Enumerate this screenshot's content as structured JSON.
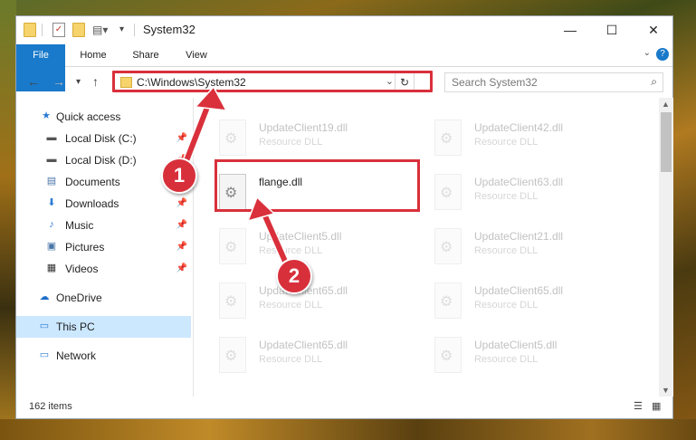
{
  "window": {
    "title": "System32",
    "controls": {
      "minimize": "—",
      "maximize": "☐",
      "close": "✕"
    }
  },
  "ribbon": {
    "tabs": [
      "File",
      "Home",
      "Share",
      "View"
    ],
    "help": "?"
  },
  "address_bar": {
    "path": "C:\\Windows\\System32"
  },
  "search": {
    "placeholder": "Search System32"
  },
  "sidebar": {
    "items": [
      {
        "label": "Quick access",
        "icon": "star-icon",
        "pinned": false
      },
      {
        "label": "Local Disk (C:)",
        "icon": "drive-icon",
        "pinned": true
      },
      {
        "label": "Local Disk (D:)",
        "icon": "drive-icon",
        "pinned": true
      },
      {
        "label": "Documents",
        "icon": "document-icon",
        "pinned": true
      },
      {
        "label": "Downloads",
        "icon": "download-icon",
        "pinned": true
      },
      {
        "label": "Music",
        "icon": "music-icon",
        "pinned": true
      },
      {
        "label": "Pictures",
        "icon": "picture-icon",
        "pinned": true
      },
      {
        "label": "Videos",
        "icon": "video-icon",
        "pinned": true
      },
      {
        "label": "OneDrive",
        "icon": "cloud-icon",
        "pinned": false
      },
      {
        "label": "This PC",
        "icon": "computer-icon",
        "pinned": false
      },
      {
        "label": "Network",
        "icon": "network-icon",
        "pinned": false
      }
    ]
  },
  "files": [
    {
      "name": "UpdateClient19.dll",
      "type": "Resource DLL",
      "faded": true
    },
    {
      "name": "UpdateClient42.dll",
      "type": "Resource DLL",
      "faded": true
    },
    {
      "name": "flange.dll",
      "type": "",
      "faded": false
    },
    {
      "name": "UpdateClient63.dll",
      "type": "Resource DLL",
      "faded": true
    },
    {
      "name": "UpdateClient5.dll",
      "type": "Resource DLL",
      "faded": true
    },
    {
      "name": "UpdateClient21.dll",
      "type": "Resource DLL",
      "faded": true
    },
    {
      "name": "UpdateClient65.dll",
      "type": "Resource DLL",
      "faded": true
    },
    {
      "name": "UpdateClient65.dll",
      "type": "Resource DLL",
      "faded": true
    },
    {
      "name": "UpdateClient65.dll",
      "type": "Resource DLL",
      "faded": true
    },
    {
      "name": "UpdateClient5.dll",
      "type": "Resource DLL",
      "faded": true
    }
  ],
  "status": {
    "item_count": "162 items"
  },
  "annotations": {
    "step1": "1",
    "step2": "2",
    "highlight_color": "#d9303b"
  }
}
